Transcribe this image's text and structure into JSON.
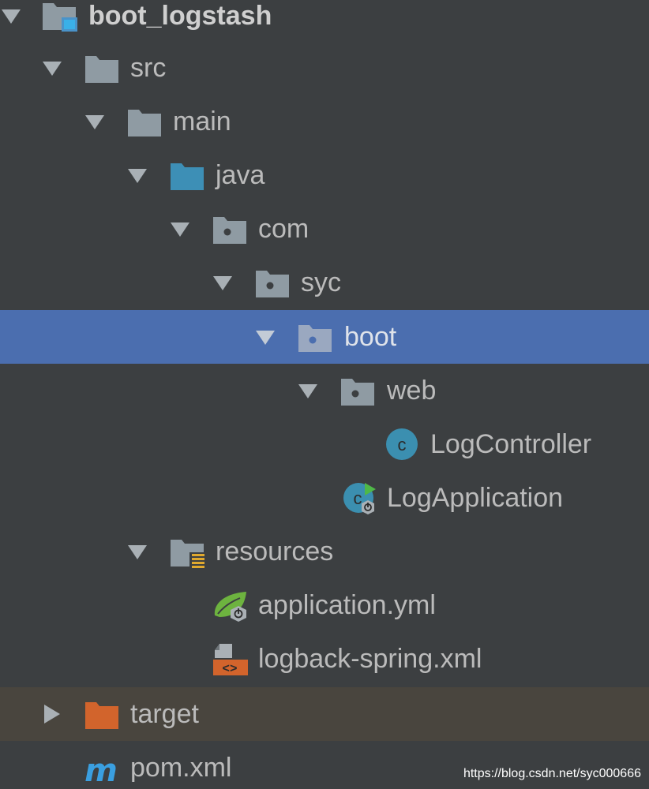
{
  "colors": {
    "background": "#3c3f41",
    "selected_row": "#4b6eaf",
    "excluded_row": "#49453e",
    "folder_gray": "#8f9ba3",
    "source_folder_blue": "#3d8fb6",
    "excluded_folder_orange": "#d2642c",
    "class_icon_teal": "#3b8fb0",
    "spring_green": "#6db33f",
    "maven_blue": "#3a9fe0",
    "text": "#bbbbbb"
  },
  "tree": [
    {
      "label": "boot_logstash",
      "icon": "module-folder-icon",
      "expanded": true,
      "depth": 0
    },
    {
      "label": "src",
      "icon": "folder-icon",
      "expanded": true,
      "depth": 1
    },
    {
      "label": "main",
      "icon": "folder-icon",
      "expanded": true,
      "depth": 2
    },
    {
      "label": "java",
      "icon": "source-root-folder-icon",
      "expanded": true,
      "depth": 3
    },
    {
      "label": "com",
      "icon": "package-icon",
      "expanded": true,
      "depth": 4
    },
    {
      "label": "syc",
      "icon": "package-icon",
      "expanded": true,
      "depth": 5
    },
    {
      "label": "boot",
      "icon": "package-icon",
      "expanded": true,
      "depth": 6,
      "selected": true
    },
    {
      "label": "web",
      "icon": "package-icon",
      "expanded": true,
      "depth": 7
    },
    {
      "label": "LogController",
      "icon": "java-class-icon",
      "depth": 8
    },
    {
      "label": "LogApplication",
      "icon": "spring-boot-application-icon",
      "depth": 7
    },
    {
      "label": "resources",
      "icon": "resources-folder-icon",
      "expanded": true,
      "depth": 3
    },
    {
      "label": "application.yml",
      "icon": "spring-config-icon",
      "depth": 4
    },
    {
      "label": "logback-spring.xml",
      "icon": "xml-file-icon",
      "depth": 4
    },
    {
      "label": "target",
      "icon": "excluded-folder-icon",
      "expanded": false,
      "depth": 1,
      "excluded": true
    },
    {
      "label": "pom.xml",
      "icon": "maven-icon",
      "depth": 1
    }
  ],
  "watermark": "https://blog.csdn.net/syc000666"
}
